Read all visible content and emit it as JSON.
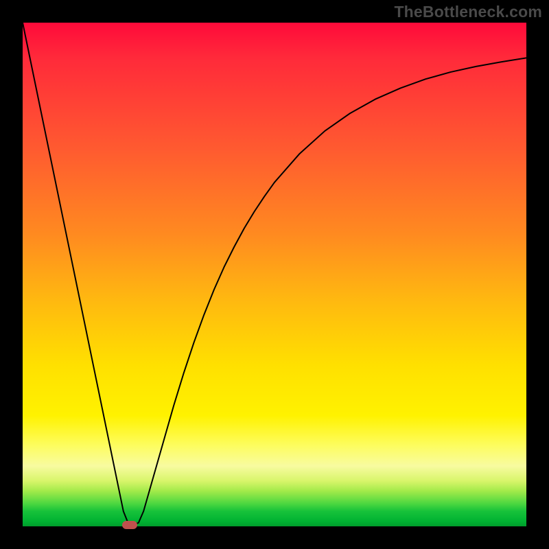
{
  "watermark": "TheBottleneck.com",
  "chart_data": {
    "type": "line",
    "title": "",
    "xlabel": "",
    "ylabel": "",
    "xlim": [
      0,
      100
    ],
    "ylim": [
      0,
      100
    ],
    "grid": false,
    "series": [
      {
        "name": "bottleneck-curve",
        "x": [
          0,
          2,
          4,
          6,
          8,
          10,
          12,
          14,
          16,
          18,
          20,
          21,
          22,
          23,
          24,
          26,
          28,
          30,
          32,
          34,
          36,
          38,
          40,
          42,
          44,
          46,
          48,
          50,
          55,
          60,
          65,
          70,
          75,
          80,
          85,
          90,
          95,
          100
        ],
        "y": [
          100,
          90.3,
          80.6,
          70.9,
          61.2,
          51.5,
          41.8,
          32.1,
          22.4,
          12.7,
          3.0,
          0.5,
          0.3,
          0.7,
          3.0,
          10.0,
          17.0,
          24.0,
          30.5,
          36.5,
          42.0,
          47.0,
          51.5,
          55.5,
          59.2,
          62.5,
          65.5,
          68.3,
          74.0,
          78.5,
          82.0,
          84.8,
          87.0,
          88.8,
          90.2,
          91.3,
          92.2,
          93.0
        ]
      }
    ],
    "optimum_marker": {
      "x": 21.3,
      "y": 0.3,
      "color": "#c0504d"
    },
    "gradient_stops": [
      {
        "pct": 0,
        "color": "#ff0a3a"
      },
      {
        "pct": 25,
        "color": "#ff5a30"
      },
      {
        "pct": 55,
        "color": "#ffb810"
      },
      {
        "pct": 78,
        "color": "#fff200"
      },
      {
        "pct": 93,
        "color": "#a2ea4a"
      },
      {
        "pct": 100,
        "color": "#009c2c"
      }
    ]
  }
}
